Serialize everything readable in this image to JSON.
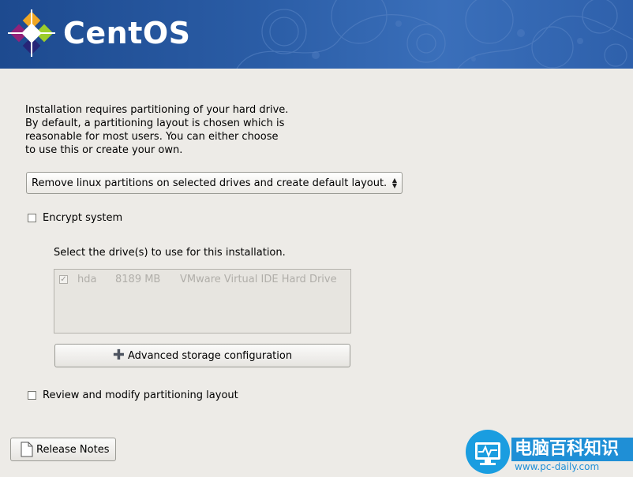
{
  "header": {
    "brand_name": "CentOS"
  },
  "intro_text": "Installation requires partitioning of your hard drive.\nBy default, a partitioning layout is chosen which is\nreasonable for most users.  You can either choose\nto use this or create your own.",
  "layout_select": {
    "selected": "Remove linux partitions on selected drives and create default layout."
  },
  "encrypt": {
    "label": "Encrypt system",
    "checked": false
  },
  "drives": {
    "label": "Select the drive(s) to use for this installation.",
    "items": [
      {
        "checked": true,
        "name": "hda",
        "size": "8189 MB",
        "model": "VMware Virtual IDE Hard Drive"
      }
    ]
  },
  "advanced_button": {
    "label": "Advanced storage configuration",
    "icon": "plus-icon"
  },
  "review": {
    "label": "Review and modify partitioning layout",
    "checked": false
  },
  "release_notes_button": {
    "label": "Release Notes",
    "icon": "document-icon"
  },
  "watermark": {
    "title": "电脑百科知识",
    "url": "www.pc-daily.com"
  },
  "colors": {
    "header_bg": "#2a5ca5",
    "page_bg": "#edebe7",
    "watermark_blue": "#1f8fd6"
  }
}
